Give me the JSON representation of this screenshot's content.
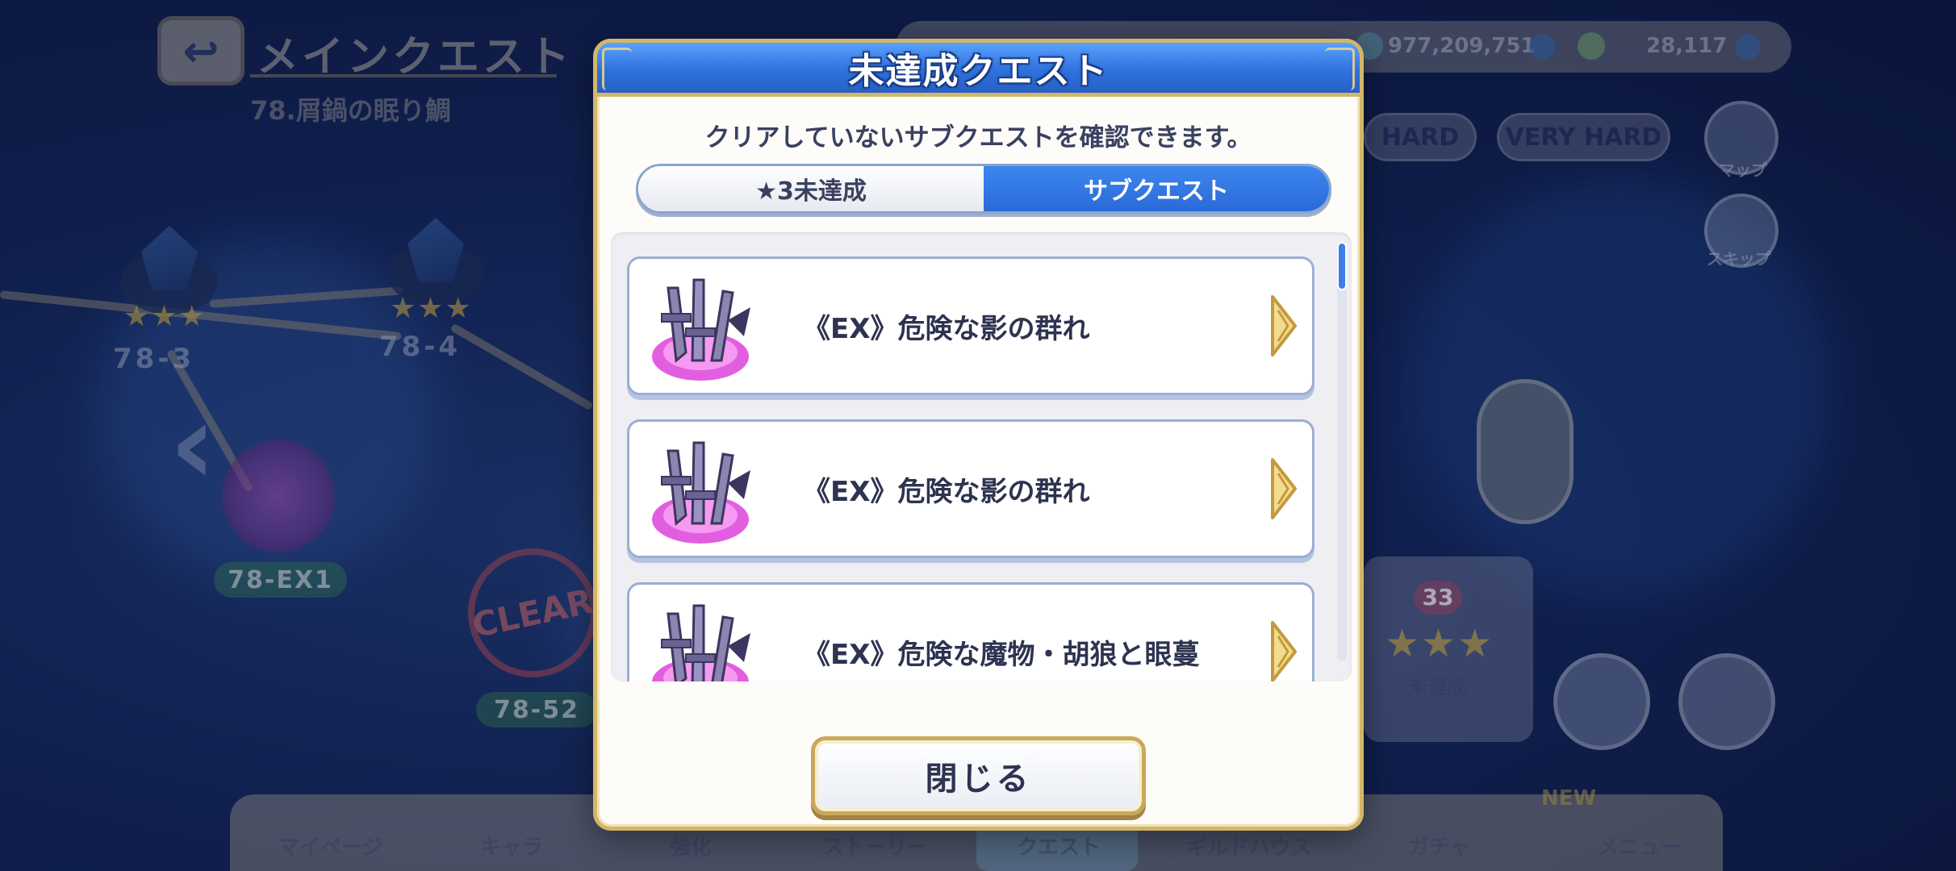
{
  "background": {
    "title": "メインクエスト",
    "subtitle": "78.屑鍋の眠り鯛",
    "status": {
      "jewels": "977,209,751",
      "coins": "28,117"
    },
    "difficulty_buttons": [
      "HARD",
      "VERY HARD"
    ],
    "side_buttons": [
      "マップ",
      "スキップ"
    ],
    "nodes": [
      "78-3",
      "78-4"
    ],
    "ex_badges": [
      "78-EX1",
      "78-52"
    ],
    "clear_stamp": "CLEAR",
    "mission": {
      "count": "33",
      "label": "未達成"
    },
    "bottom_nav": [
      "マイページ",
      "キャラ",
      "強化",
      "ストーリー",
      "クエスト",
      "ギルドハウス",
      "ガチャ",
      "メニュー"
    ],
    "new_badge": "NEW"
  },
  "modal": {
    "title": "未達成クエスト",
    "description": "クリアしていないサブクエストを確認できます。",
    "tabs": [
      {
        "label": "★3未達成",
        "active": false
      },
      {
        "label": "サブクエスト",
        "active": true
      }
    ],
    "quests": [
      {
        "label": "《EX》危険な影の群れ",
        "icon": "dark-sword-crystal-icon"
      },
      {
        "label": "《EX》危険な影の群れ",
        "icon": "dark-sword-crystal-icon"
      },
      {
        "label": "《EX》危険な魔物・胡狼と眼蔓",
        "icon": "dark-sword-crystal-icon"
      }
    ],
    "close_label": "閉じる"
  },
  "colors": {
    "header_blue": "#2f72dd",
    "active_tab": "#2a6ad8",
    "gold_border": "#d4b668",
    "text_dark": "#2d3350"
  }
}
